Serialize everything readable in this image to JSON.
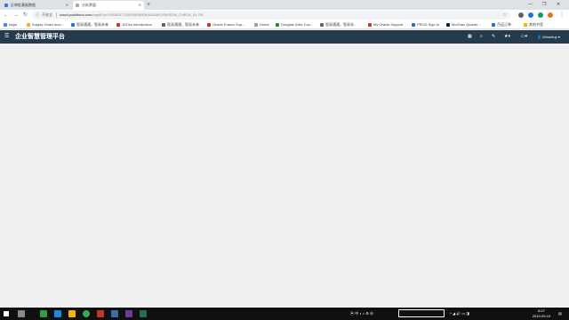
{
  "browser": {
    "tabs": [
      {
        "label": "反审批基础数据",
        "active": false
      },
      {
        "label": "分析界面",
        "active": true
      }
    ],
    "address": {
      "security": "不安全",
      "host": "cloud.yunhitech.com",
      "path": "/sap/#?p=10020017133109535938;ND1&R;205;R205_CHECK_ID;791"
    },
    "bookmarks": [
      {
        "label": "Apps",
        "color": "#4285f4"
      },
      {
        "label": "Supply Chain mon...",
        "color": "#f4b400"
      },
      {
        "label": "智采通通，智采未来",
        "color": "#1a73e8"
      },
      {
        "label": "JDOcs introduction",
        "color": "#d93025"
      },
      {
        "label": "智采通通，智采未来",
        "color": "#5f6368"
      },
      {
        "label": "Oracle Fusion Sup...",
        "color": "#d93025"
      },
      {
        "label": "Home",
        "color": "#9aa0a6"
      },
      {
        "label": "Douglas Voltz Cou...",
        "color": "#1e8e3e"
      },
      {
        "label": "智采通通，智采未...",
        "color": "#5f6368"
      },
      {
        "label": "My Oracle Support",
        "color": "#d93025"
      },
      {
        "label": "PROD Sign In",
        "color": "#1a73e8"
      },
      {
        "label": "McGraw Quarter...",
        "color": "#0b1f3a"
      },
      {
        "label": "百运订单",
        "color": "#1a73e8"
      },
      {
        "label": "其他书签",
        "color": "#f4b400"
      }
    ]
  },
  "app": {
    "title": "企业智慧管理平台",
    "user": "Winsetup"
  },
  "taskbar": {
    "tray_text": "中",
    "time": "8:27",
    "date": "2019-09-19"
  },
  "colors": {
    "appbar": "#263a4d",
    "content": "#f0f0f0",
    "taskbar": "#101010"
  }
}
